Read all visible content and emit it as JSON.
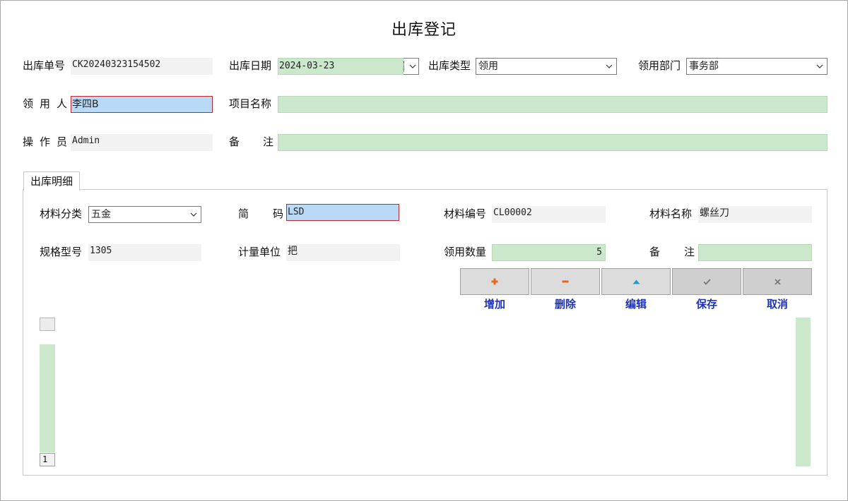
{
  "title": "出库登记",
  "header": {
    "order_no": {
      "label": "出库单号",
      "value": "CK20240323154502"
    },
    "date": {
      "label": "出库日期",
      "value": "2024-03-23"
    },
    "type": {
      "label": "出库类型",
      "value": "领用"
    },
    "dept": {
      "label": "领用部门",
      "value": "事务部"
    },
    "receiver": {
      "label_chars": [
        "领",
        "用",
        "人"
      ],
      "value": "李四B"
    },
    "project": {
      "label": "项目名称",
      "value": ""
    },
    "operator": {
      "label_chars": [
        "操",
        "作",
        "员"
      ],
      "value": "Admin"
    },
    "remark": {
      "label_chars": [
        "备",
        "注"
      ],
      "value": ""
    }
  },
  "detail_tab": {
    "label": "出库明细"
  },
  "detail": {
    "category": {
      "label": "材料分类",
      "value": "五金"
    },
    "short_code": {
      "label_chars": [
        "简",
        "码"
      ],
      "value": "LSD"
    },
    "material_code": {
      "label": "材料编号",
      "value": "CL00002"
    },
    "material_name": {
      "label": "材料名称",
      "value": "螺丝刀"
    },
    "spec": {
      "label": "规格型号",
      "value": "1305"
    },
    "unit": {
      "label": "计量单位",
      "value": "把"
    },
    "quantity": {
      "label": "领用数量",
      "value": "5"
    },
    "remark": {
      "label_chars": [
        "备",
        "注"
      ],
      "value": ""
    }
  },
  "toolbar": {
    "add": {
      "label": "增加",
      "icon": "plus-icon",
      "color": "#e8671c"
    },
    "delete": {
      "label": "删除",
      "icon": "minus-icon",
      "color": "#e8671c"
    },
    "edit": {
      "label": "编辑",
      "icon": "triangle-up-icon",
      "color": "#1aa0c8"
    },
    "save": {
      "label": "保存",
      "icon": "check-icon",
      "color": "#777777"
    },
    "cancel": {
      "label": "取消",
      "icon": "close-icon",
      "color": "#777777"
    }
  },
  "grid": {
    "page_number": "1"
  },
  "colors": {
    "field_green": "#cbe8cc",
    "field_selected": "#b9daf7",
    "focus_border": "#c0282d",
    "button_label": "#1f34b8"
  }
}
